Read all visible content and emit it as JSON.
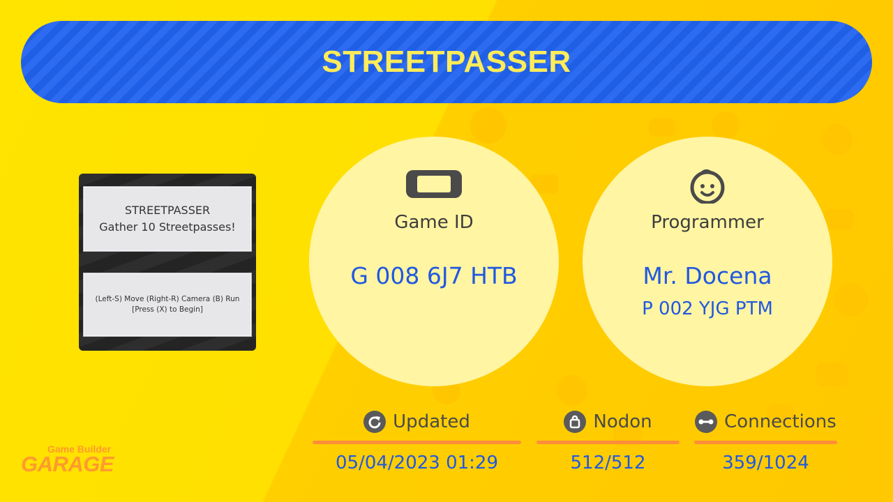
{
  "title": "STREETPASSER",
  "thumbnail": {
    "card1_line1": "STREETPASSER",
    "card1_line2": "Gather 10 Streetpasses!",
    "card2_line1": "(Left-S) Move    (Right-R) Camera    (B) Run",
    "card2_line2": "[Press (X) to Begin]"
  },
  "game_id": {
    "icon": "switch-console-icon",
    "label": "Game ID",
    "value": "G 008 6J7 HTB"
  },
  "programmer": {
    "icon": "face-icon",
    "label": "Programmer",
    "name": "Mr. Docena",
    "id": "P 002 YJG PTM"
  },
  "stats": {
    "updated": {
      "icon": "refresh-icon",
      "label": "Updated",
      "value": "05/04/2023 01:29"
    },
    "nodon": {
      "icon": "lock-icon",
      "label": "Nodon",
      "value": "512/512"
    },
    "connections": {
      "icon": "link-icon",
      "label": "Connections",
      "value": "359/1024"
    }
  },
  "logo": {
    "line1": "Game Builder",
    "line2": "GARAGE"
  },
  "colors": {
    "background": "#ffe000",
    "title_bar": "#1f5fe6",
    "title_text": "#ffec5a",
    "circle": "#fff5a3",
    "value_blue": "#2158e0",
    "rule_orange": "#ff8d3a"
  }
}
